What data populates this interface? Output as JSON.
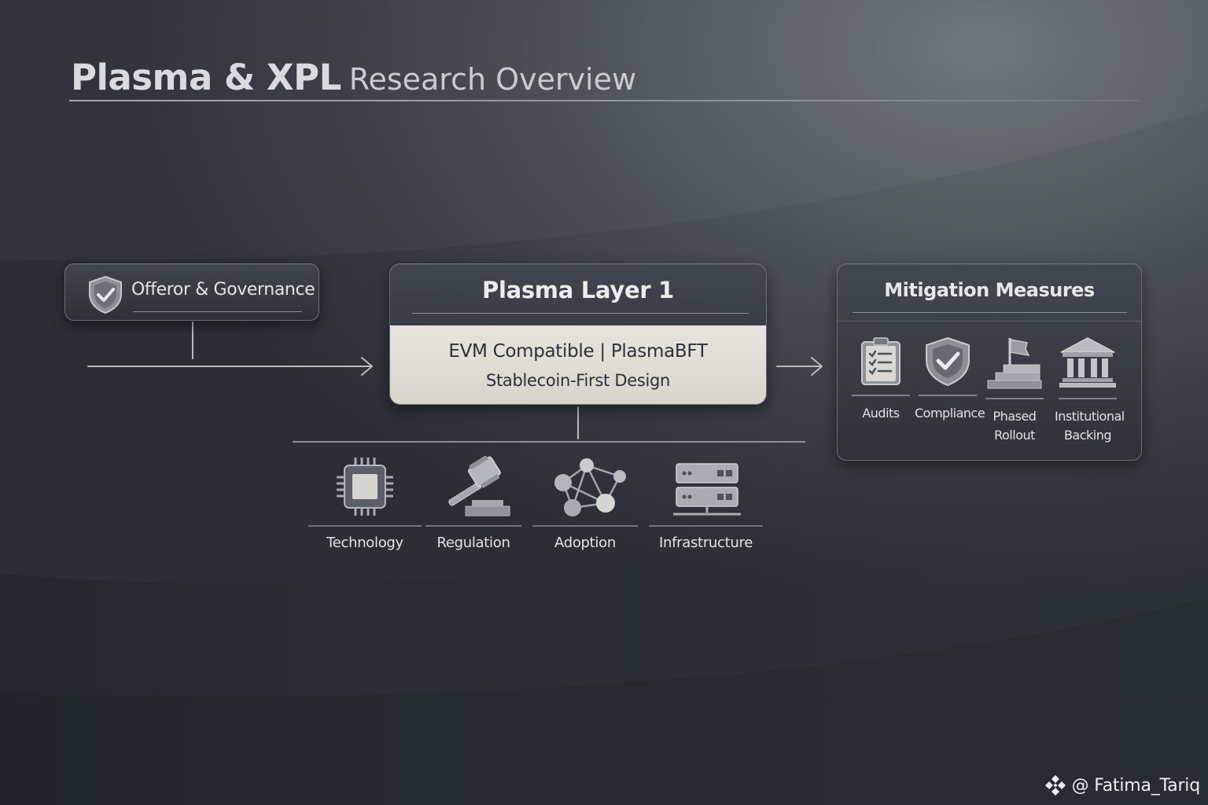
{
  "title": {
    "bold": "Plasma & XPL",
    "light": "Research Overview"
  },
  "offeror": {
    "label": "Offeror & Governance",
    "icon": "shield-check-icon"
  },
  "central": {
    "title": "Plasma Layer 1",
    "line1": "EVM Compatible | PlasmaBFT",
    "line2": "Stablecoin-First Design"
  },
  "mitigation": {
    "title": "Mitigation Measures",
    "items": [
      {
        "line1": "Audits",
        "line2": "",
        "icon": "checklist-icon"
      },
      {
        "line1": "Compliance",
        "line2": "",
        "icon": "shield-check-icon"
      },
      {
        "line1": "Phased",
        "line2": "Rollout",
        "icon": "flag-stairs-icon"
      },
      {
        "line1": "Institutional",
        "line2": "Backing",
        "icon": "bank-icon"
      }
    ]
  },
  "categories": [
    {
      "label": "Technology",
      "icon": "chip-icon"
    },
    {
      "label": "Regulation",
      "icon": "gavel-icon"
    },
    {
      "label": "Adoption",
      "icon": "network-icon"
    },
    {
      "label": "Infrastructure",
      "icon": "server-icon"
    }
  ],
  "watermark": {
    "label": "@ Fatima_Tariq",
    "icon": "binance-logo-icon"
  },
  "colors": {
    "card_light": "#e3e1db",
    "accent_line": "#9a9da4",
    "background_dark": "#2b2e36"
  }
}
